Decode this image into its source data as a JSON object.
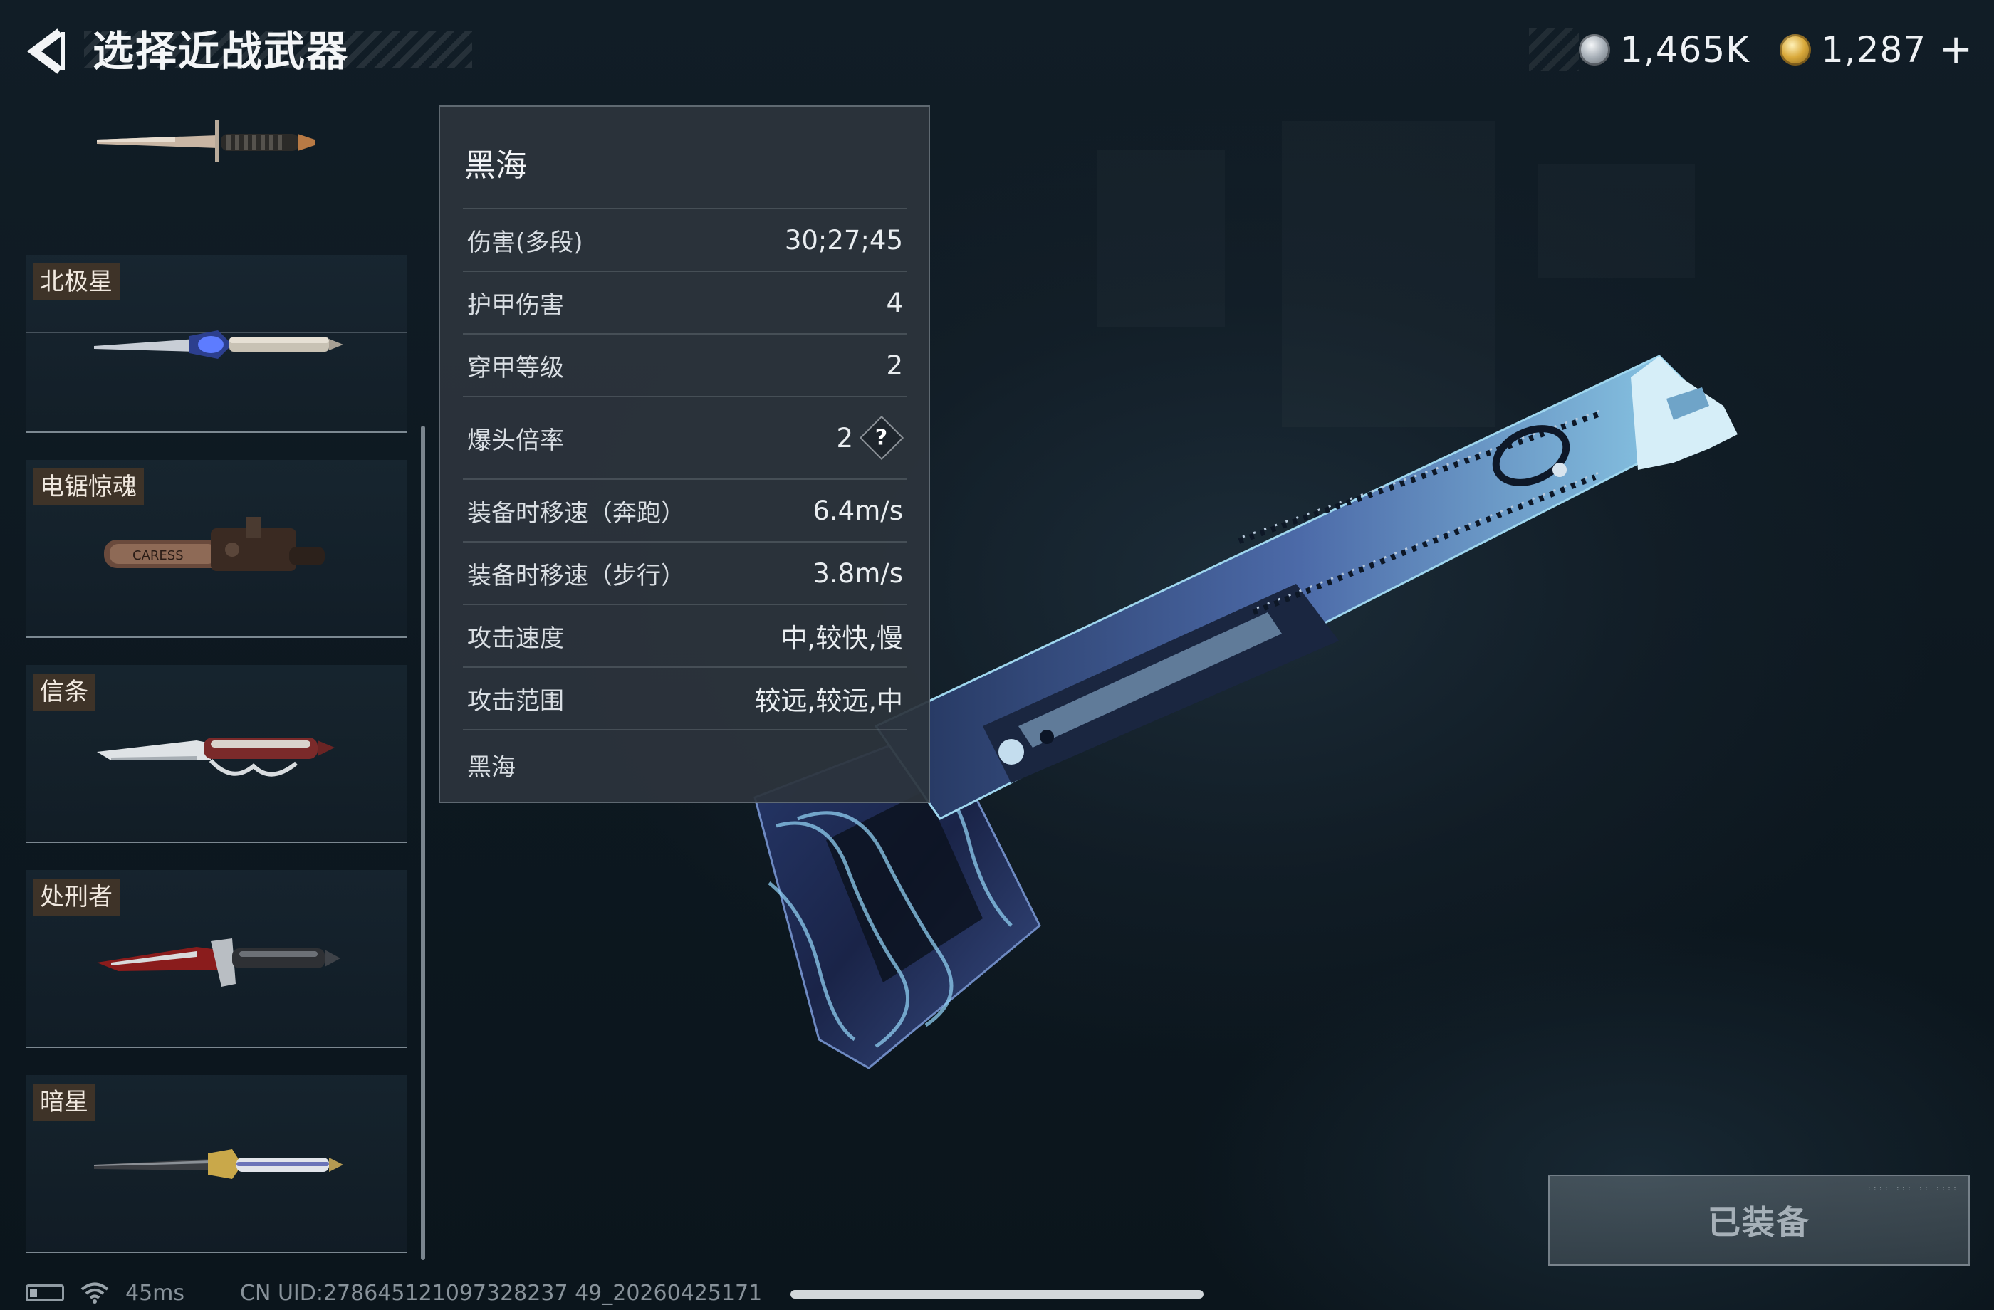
{
  "header": {
    "title": "选择近战武器",
    "back_icon": "chevron-left-icon"
  },
  "currency": {
    "silver": {
      "icon": "silver-coin-icon",
      "value": "1,465K"
    },
    "gold": {
      "icon": "gold-coin-icon",
      "value": "1,287"
    },
    "add_label": "+"
  },
  "weapon_list": {
    "items": [
      {
        "label": "",
        "icon": "dagger-icon",
        "selected": false
      },
      {
        "label": "北极星",
        "icon": "polaris-knife-icon",
        "selected": false
      },
      {
        "label": "电锯惊魂",
        "icon": "chainsaw-icon",
        "selected": false
      },
      {
        "label": "信条",
        "icon": "serrated-knife-icon",
        "selected": false
      },
      {
        "label": "处刑者",
        "icon": "combat-knife-icon",
        "selected": false
      },
      {
        "label": "暗星",
        "icon": "katana-icon",
        "selected": false
      }
    ]
  },
  "stats_panel": {
    "title": "黑海",
    "stats": [
      {
        "label": "伤害(多段)",
        "value": "30;27;45"
      },
      {
        "label": "护甲伤害",
        "value": "4"
      },
      {
        "label": "穿甲等级",
        "value": "2"
      },
      {
        "label": "爆头倍率",
        "value": "2",
        "help": "?"
      },
      {
        "label": "装备时移速（奔跑）",
        "value": "6.4m/s"
      },
      {
        "label": "装备时移速（步行）",
        "value": "3.8m/s"
      },
      {
        "label": "攻击速度",
        "value": "中,较快,慢"
      },
      {
        "label": "攻击范围",
        "value": "较远,较远,中"
      }
    ],
    "footer": "黑海"
  },
  "weapon_display": {
    "icon": "black-sea-hatchet-icon"
  },
  "equip_button": {
    "label": "已装备",
    "state": "equipped"
  },
  "status_bar": {
    "battery_icon": "battery-icon",
    "wifi_icon": "wifi-icon",
    "ping": "45ms",
    "uid": "CN UID:278645121097328237 49_20260425171"
  },
  "colors": {
    "background": "#0f1b23",
    "panel": "#2c343c",
    "name_tag": "#3e3328",
    "gold": "#d9a93b",
    "weapon_accent": "#6fb3d8"
  }
}
